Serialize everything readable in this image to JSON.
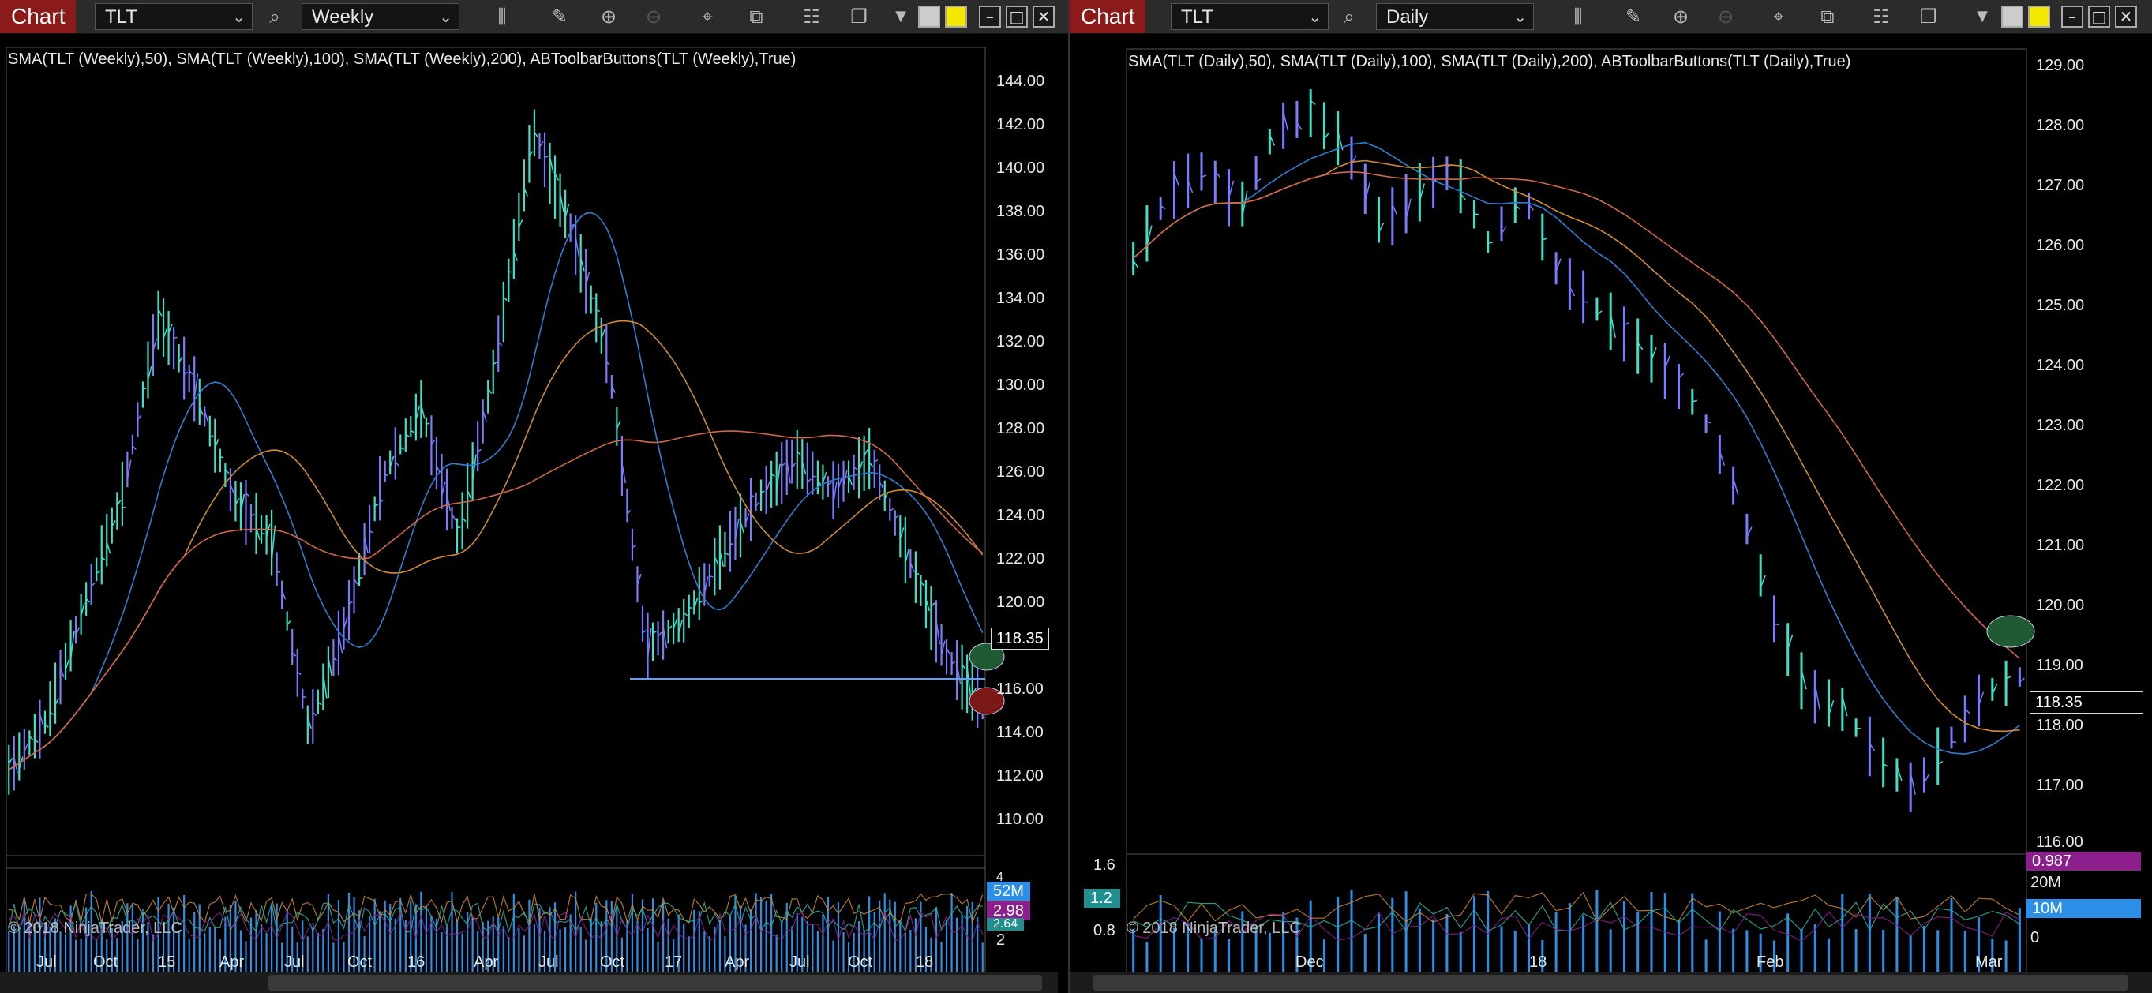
{
  "left": {
    "tab_label": "Chart",
    "instrument": "TLT",
    "interval": "Weekly",
    "indicator_label": "SMA(TLT (Weekly),50), SMA(TLT (Weekly),100), SMA(TLT (Weekly),200), ABToolbarButtons(TLT (Weekly),True)",
    "price_labels": [
      "144.00",
      "142.00",
      "140.00",
      "138.00",
      "136.00",
      "134.00",
      "132.00",
      "130.00",
      "128.00",
      "126.00",
      "124.00",
      "122.00",
      "120.00",
      "116.00",
      "114.00",
      "112.00",
      "110.00"
    ],
    "last_price": "118.35",
    "volume_labels": [
      "4",
      "2"
    ],
    "volume_last": "52M",
    "ratio_last": "2.98",
    "ratio_other": "2.64",
    "x_labels": [
      "Jul",
      "Oct",
      "15",
      "Apr",
      "Jul",
      "Oct",
      "16",
      "Apr",
      "Jul",
      "Oct",
      "17",
      "Apr",
      "Jul",
      "Oct",
      "18"
    ],
    "copyright": "© 2018 NinjaTrader, LLC"
  },
  "right": {
    "tab_label": "Chart",
    "instrument": "TLT",
    "interval": "Daily",
    "indicator_label": "SMA(TLT (Daily),50), SMA(TLT (Daily),100), SMA(TLT (Daily),200), ABToolbarButtons(TLT (Daily),True)",
    "price_labels": [
      "129.00",
      "128.00",
      "127.00",
      "126.00",
      "125.00",
      "124.00",
      "123.00",
      "122.00",
      "121.00",
      "120.00",
      "119.00",
      "118.00",
      "117.00",
      "116.00"
    ],
    "last_price": "118.35",
    "ratio_top": "0.987",
    "volume_labels": [
      "20M",
      "0"
    ],
    "volume_last": "10M",
    "ratio_left_labels": [
      "1.6",
      "0.8"
    ],
    "ratio_left_value": "1.2",
    "x_labels": [
      "Dec",
      "18",
      "Feb",
      "Mar"
    ],
    "copyright": "© 2018 NinjaTrader, LLC"
  },
  "colors": {
    "tab": "#8b1a1a",
    "bar_up": "#40e0c8",
    "bar_down": "#7b7bff",
    "sma50": "#2f7fd0",
    "sma100": "#d08a35",
    "sma200": "#d0664a",
    "volume": "#2b8fe8",
    "ratio_box": "#8c1f8c",
    "teal_box": "#1f8f8f"
  }
}
